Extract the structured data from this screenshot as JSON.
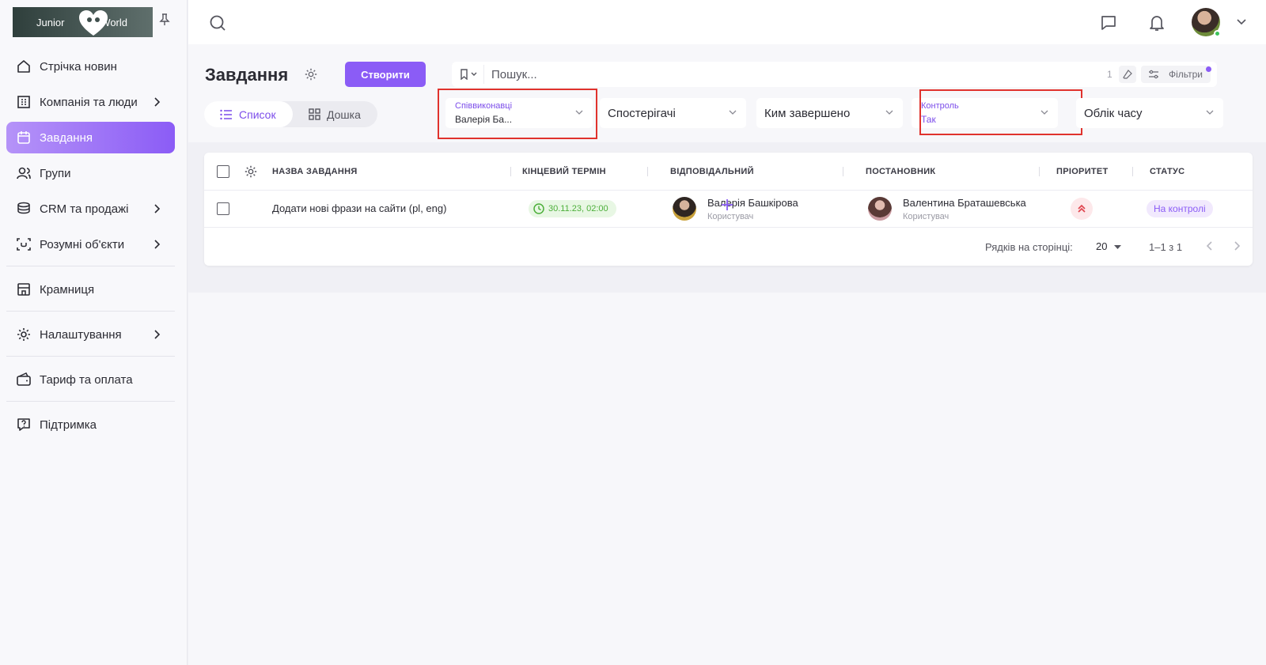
{
  "logo": {
    "left": "Junior",
    "right": "World"
  },
  "sidebar": {
    "items": [
      {
        "label": "Стрічка новин",
        "icon": "home-icon"
      },
      {
        "label": "Компанія та люди",
        "icon": "building-icon",
        "expandable": true
      },
      {
        "label": "Завдання",
        "icon": "calendar-icon",
        "active": true
      },
      {
        "label": "Групи",
        "icon": "users-icon"
      },
      {
        "label": "CRM та продажі",
        "icon": "coins-icon",
        "expandable": true
      },
      {
        "label": "Розумні об'єкти",
        "icon": "scan-face-icon",
        "expandable": true
      },
      {
        "label": "Крамниця",
        "icon": "store-icon"
      },
      {
        "label": "Налаштування",
        "icon": "gear-icon",
        "expandable": true
      },
      {
        "label": "Тариф та оплата",
        "icon": "wallet-icon"
      },
      {
        "label": "Підтримка",
        "icon": "help-chat-icon"
      }
    ]
  },
  "page": {
    "title": "Завдання",
    "create_label": "Створити",
    "search_placeholder": "Пошук...",
    "search_count": "1",
    "filters_label": "Фільтри",
    "view_list": "Список",
    "view_board": "Дошка"
  },
  "filters": {
    "coexecutors": {
      "label": "Співвиконавці",
      "value": "Валерія Ба..."
    },
    "observers": {
      "placeholder": "Спостерігачі"
    },
    "completed_by": {
      "placeholder": "Ким завершено"
    },
    "control": {
      "label": "Контроль",
      "value": "Так"
    },
    "time_tracking": {
      "placeholder": "Облік часу"
    }
  },
  "table": {
    "columns": [
      "НАЗВА ЗАВДАННЯ",
      "КІНЦЕВИЙ ТЕРМІН",
      "ВІДПОВІДАЛЬНИЙ",
      "ПОСТАНОВНИК",
      "ПРІОРИТЕТ",
      "СТАТУС"
    ],
    "rows": [
      {
        "name": "Додати нові фрази на сайти (pl, eng)",
        "deadline": "30.11.23, 02:00",
        "responsible": {
          "name": "Валерія Башкірова",
          "role": "Користувач"
        },
        "author": {
          "name": "Валентина Браташевська",
          "role": "Користувач"
        },
        "priority": "high",
        "status": "На контролі"
      }
    ]
  },
  "pagination": {
    "rows_per_page_label": "Рядків на сторінці:",
    "rows_per_page": "20",
    "range": "1–1 з 1"
  },
  "colors": {
    "accent": "#8b5cf6",
    "highlight": "#e0322d",
    "deadline_green": "#4caf3a",
    "priority_red": "#e0454f"
  }
}
